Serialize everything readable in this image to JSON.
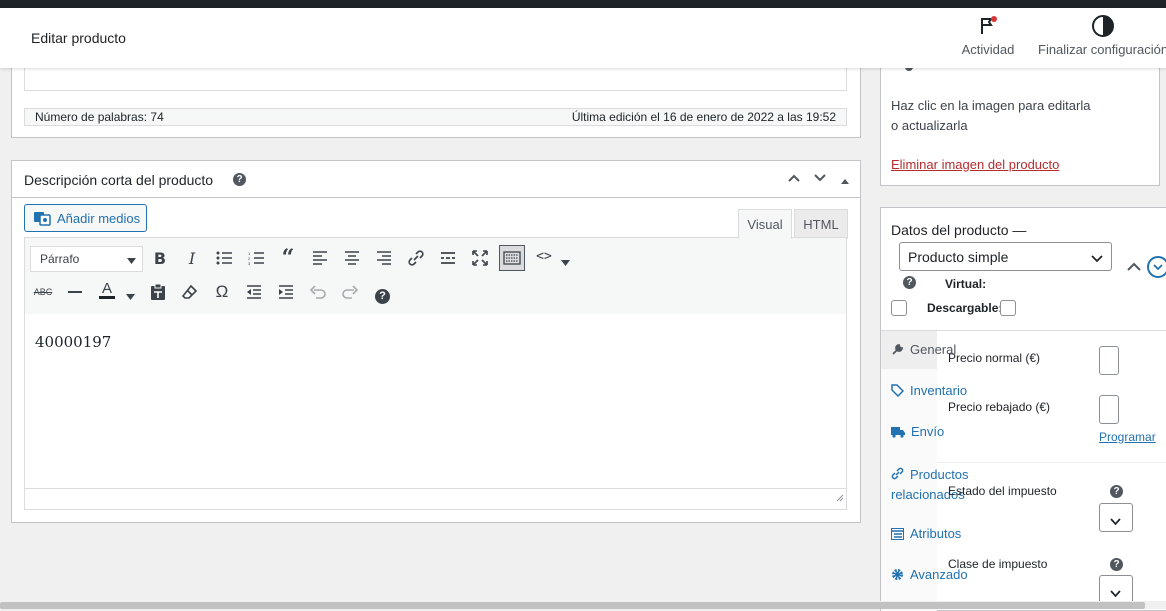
{
  "header": {
    "page_title": "Editar producto",
    "activity_label": "Actividad",
    "setup_label": "Finalizar configuración"
  },
  "main_editor": {
    "word_count": "Número de palabras: 74",
    "last_edit": "Última edición el 16 de enero de 2022 a las 19:52"
  },
  "short_desc": {
    "title": "Descripción corta del producto",
    "add_media": "Añadir medios",
    "tab_visual": "Visual",
    "tab_html": "HTML",
    "format_select": "Párrafo",
    "content": "40000197"
  },
  "image_box": {
    "hint_line1": "Haz clic en la imagen para editarla",
    "hint_line2": "o actualizarla",
    "remove_link": "Eliminar imagen del producto"
  },
  "product_data": {
    "title": "Datos del producto —",
    "type_select": "Producto simple",
    "virtual_label": "Virtual:",
    "downloadable_label": "Descargable:",
    "tabs": [
      {
        "label": "General"
      },
      {
        "label": "Inventario"
      },
      {
        "label": "Envío"
      },
      {
        "label": "Productos relacionados"
      },
      {
        "label": "Atributos"
      },
      {
        "label": "Avanzado"
      }
    ],
    "fields": {
      "regular_price": "Precio normal (€)",
      "sale_price": "Precio rebajado (€)",
      "schedule": "Programar",
      "tax_status": "Estado del impuesto",
      "tax_class": "Clase de impuesto"
    }
  },
  "colors": {
    "accent": "#2271b1",
    "link_danger": "#b32d2e",
    "admin_bar": "#1d2327",
    "notification_dot": "#d63638"
  }
}
